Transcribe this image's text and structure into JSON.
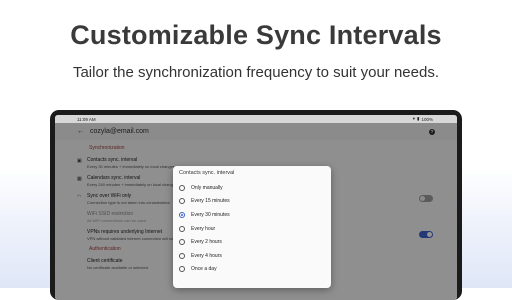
{
  "headline": "Customizable Sync Intervals",
  "subline": "Tailor the synchronization frequency to suit your needs.",
  "statusbar": {
    "time": "11:09 AM",
    "battery": "100%"
  },
  "toolbar": {
    "account": "cozyla@email.com"
  },
  "settings": {
    "section_sync": "Synchronization",
    "contacts_title": "Contacts sync. interval",
    "contacts_sub": "Every 30 minutes + immediately on local changes",
    "calendars_title": "Calendars sync. interval",
    "calendars_sub": "Every 240 minutes + immediately on local changes",
    "wifi_title": "Sync over WiFi only",
    "wifi_sub": "Connection type is not taken into consideration",
    "wifi_ssid_title": "WiFi SSID restriction",
    "wifi_ssid_sub": "All WiFi connections can be used",
    "vpn_title": "VPNs requires underlying Internet",
    "vpn_sub": "VPN without validated internet connection will not sync",
    "section_auth": "Authentication",
    "cert_title": "Client certificate",
    "cert_sub": "No certificate available or selected"
  },
  "dialog": {
    "title": "Contacts sync. interval",
    "options": [
      "Only manually",
      "Every 15 minutes",
      "Every 30 minutes",
      "Every hour",
      "Every 2 hours",
      "Every 4 hours",
      "Once a day"
    ],
    "selected": "Every 30 minutes"
  },
  "colors": {
    "accent": "#3d61c8",
    "section": "#a04040"
  }
}
